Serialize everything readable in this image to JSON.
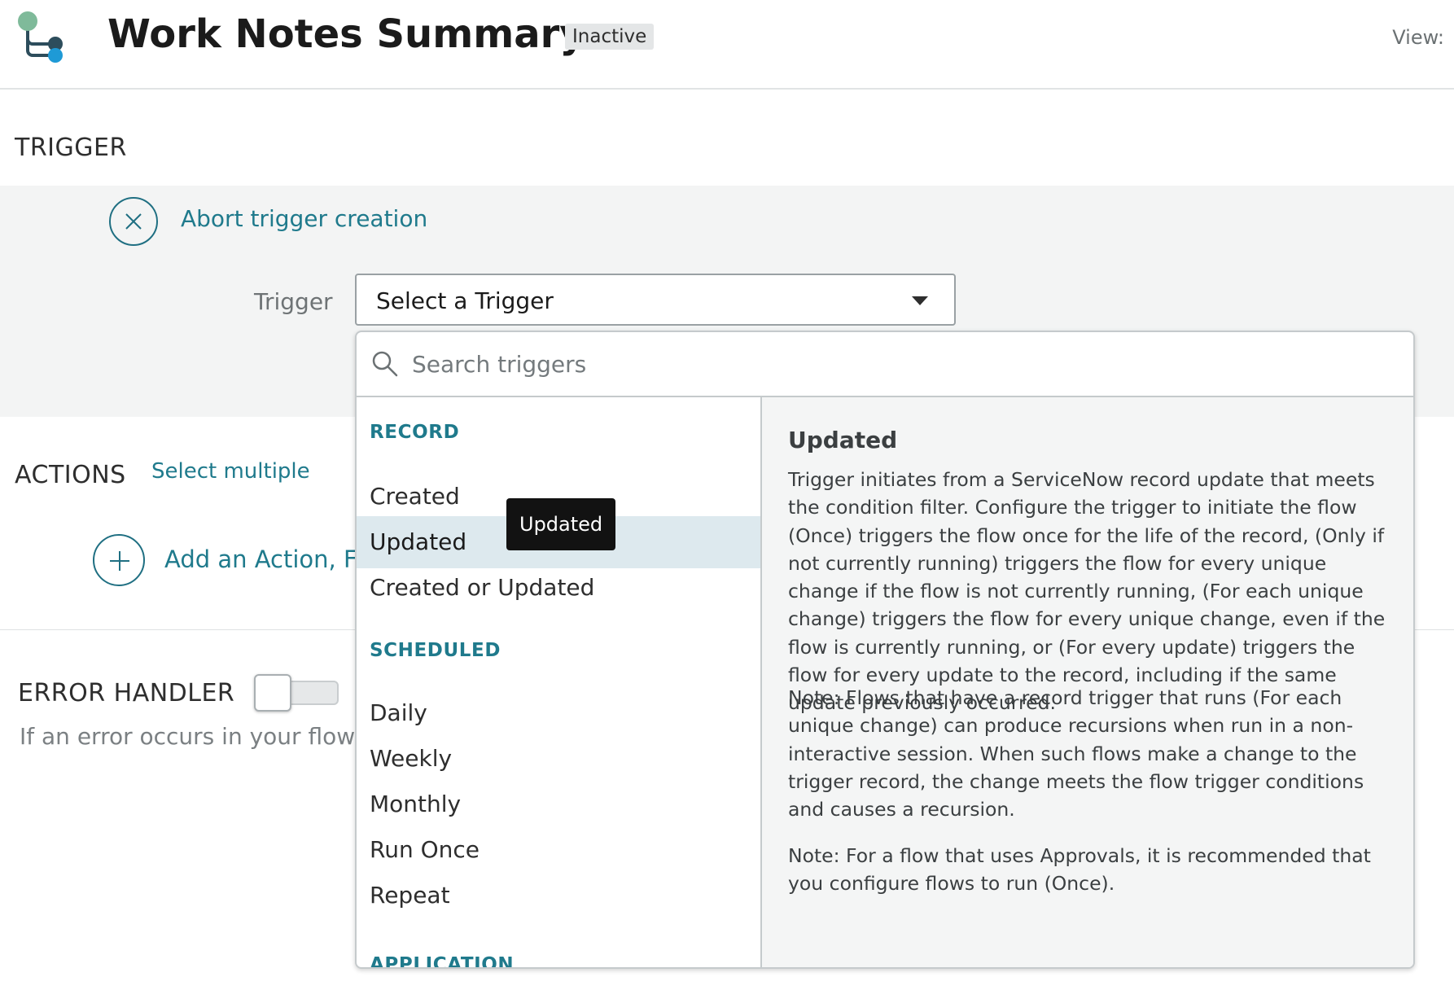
{
  "header": {
    "title": "Work Notes Summary",
    "status_badge": "Inactive",
    "view_label": "View:"
  },
  "trigger_section": {
    "title": "TRIGGER",
    "abort_link": "Abort trigger creation",
    "field_label": "Trigger",
    "select_value": "Select a Trigger"
  },
  "actions_section": {
    "title": "ACTIONS",
    "select_multiple": "Select multiple",
    "add_link": "Add an Action, Flo"
  },
  "error_section": {
    "title": "ERROR HANDLER",
    "toggle_on": false,
    "description": "If an error occurs in your flow, t"
  },
  "dropdown": {
    "search_placeholder": "Search triggers",
    "groups": [
      {
        "label": "RECORD",
        "items": [
          "Created",
          "Updated",
          "Created or Updated"
        ]
      },
      {
        "label": "SCHEDULED",
        "items": [
          "Daily",
          "Weekly",
          "Monthly",
          "Run Once",
          "Repeat"
        ]
      },
      {
        "label": "APPLICATION",
        "items": []
      }
    ],
    "highlighted_item": "Updated",
    "tooltip": "Updated",
    "detail": {
      "title": "Updated",
      "paragraphs": [
        "Trigger initiates from a ServiceNow record update that meets the condition filter. Configure the trigger to initiate the flow (Once) triggers the flow once for the life of the record, (Only if not currently running) triggers the flow for every unique change if the flow is not currently running, (For each unique change) triggers the flow for every unique change, even if the flow is currently running, or (For every update) triggers the flow for every update to the record, including if the same update previously occurred.",
        "Note: Flows that have a record trigger that runs (For each unique change) can produce recursions when run in a non-interactive session. When such flows make a change to the trigger record, the change meets the flow trigger conditions and causes a recursion.",
        "Note: For a flow that uses Approvals, it is recommended that you configure flows to run (Once)."
      ]
    }
  },
  "colors": {
    "accent": "#1f7a8c",
    "highlight_row": "#dde9ee",
    "panel_bg": "#f3f4f4"
  }
}
